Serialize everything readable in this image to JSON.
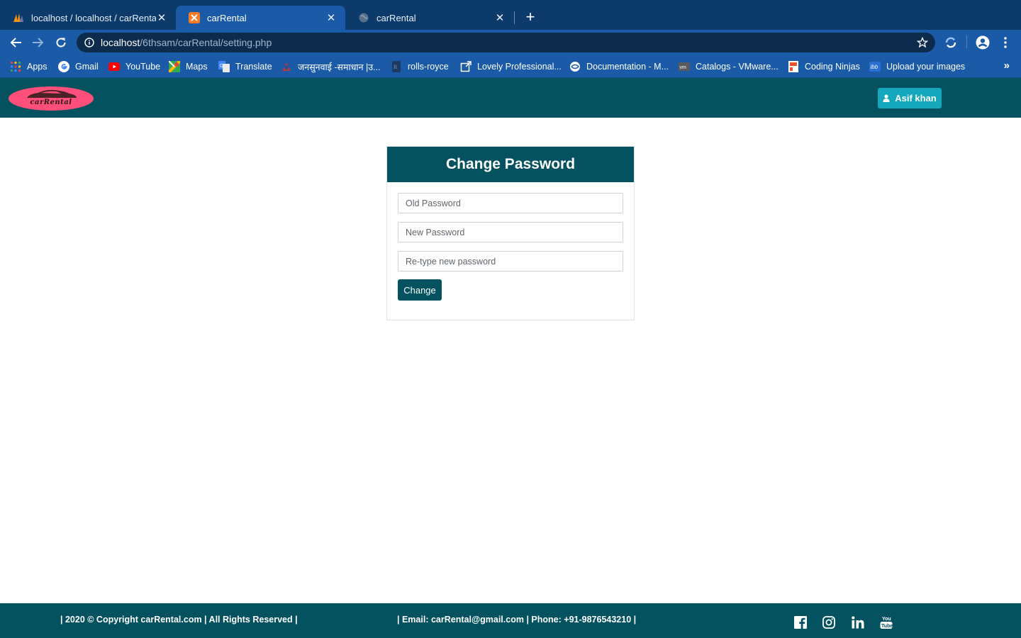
{
  "browser": {
    "tabs": [
      {
        "title": "localhost / localhost / carRental /",
        "icon": "phpmyadmin-icon",
        "active": false
      },
      {
        "title": "carRental",
        "icon": "xampp-icon",
        "active": true
      },
      {
        "title": "carRental",
        "icon": "globe-icon",
        "active": false
      }
    ],
    "new_tab": "+",
    "url_host": "localhost",
    "url_path": "/6thsam/carRental/setting.php",
    "bookmarks": [
      {
        "label": "Apps",
        "icon": "apps-grid-icon"
      },
      {
        "label": "Gmail",
        "icon": "google-icon"
      },
      {
        "label": "YouTube",
        "icon": "youtube-icon"
      },
      {
        "label": "Maps",
        "icon": "maps-icon"
      },
      {
        "label": "Translate",
        "icon": "translate-icon"
      },
      {
        "label": "जनसुनवाई -समाधान |उ...",
        "icon": "emblem-icon"
      },
      {
        "label": "rolls-royce",
        "icon": "rolls-royce-icon"
      },
      {
        "label": "Lovely Professional...",
        "icon": "external-link-icon"
      },
      {
        "label": "Documentation - M...",
        "icon": "doc-globe-icon"
      },
      {
        "label": "Catalogs - VMware...",
        "icon": "vmware-icon"
      },
      {
        "label": "Coding Ninjas",
        "icon": "coding-ninjas-icon"
      },
      {
        "label": "Upload your images",
        "icon": "ibb-icon"
      }
    ],
    "bookmarks_more": "»"
  },
  "header": {
    "logo_text": "carRental",
    "user_name": "Asif khan"
  },
  "form": {
    "title": "Change Password",
    "old_password_placeholder": "Old Password",
    "new_password_placeholder": "New Password",
    "retype_password_placeholder": "Re-type new password",
    "submit_label": "Change"
  },
  "footer": {
    "copyright": "| 2020 © Copyright carRental.com | All Rights Reserved |",
    "contact_prefix": "| Email:",
    "email": "carRental@gmail.com",
    "phone_label": "| Phone:",
    "phone": "+91-9876543210 |"
  },
  "colors": {
    "brand_teal": "#04525f",
    "user_button": "#15a7bb",
    "chrome_blue": "#1b5aa6",
    "logo_pink": "#ff4f7a"
  }
}
